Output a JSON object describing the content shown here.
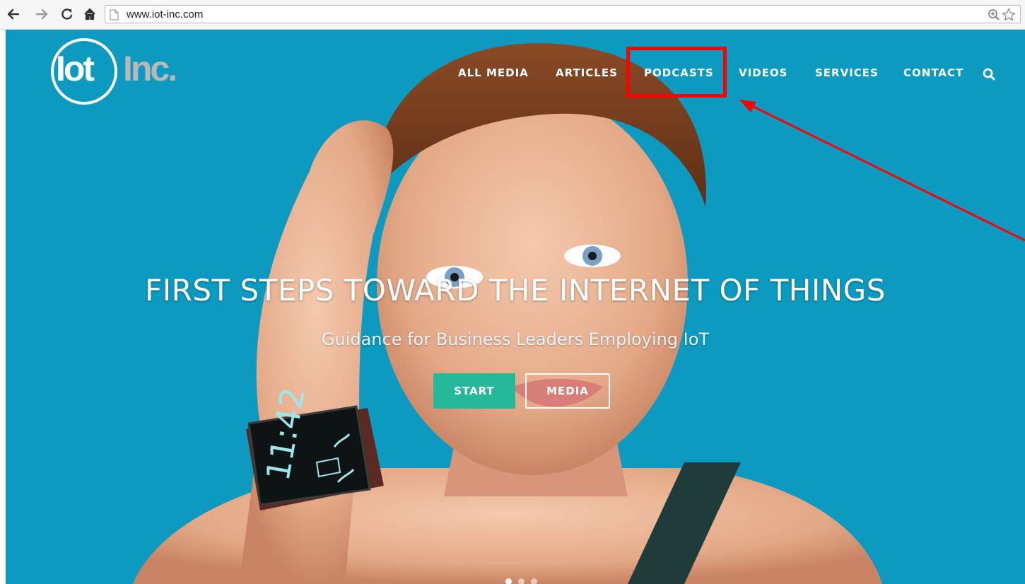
{
  "browser": {
    "url": "www.iot-inc.com",
    "back_icon": "back-arrow-icon",
    "forward_icon": "forward-arrow-icon",
    "reload_icon": "reload-icon",
    "home_icon": "home-icon"
  },
  "site": {
    "logo_left": "Iot",
    "logo_right": "Inc.",
    "nav": {
      "all_media": "ALL MEDIA",
      "articles": "ARTICLES",
      "podcasts": "PODCASTS",
      "videos": "VIDEOS",
      "services": "SERVICES",
      "contact": "CONTACT"
    },
    "colors": {
      "background": "#0d9ac0",
      "start_button": "#26b89b",
      "annotation": "#ff0000"
    }
  },
  "hero": {
    "headline": "FIRST STEPS TOWARD THE INTERNET OF THINGS",
    "subhead": "Guidance for Business Leaders Employing IoT",
    "start_label": "START",
    "media_label": "MEDIA",
    "slides_total": 3,
    "slide_active": 1
  }
}
